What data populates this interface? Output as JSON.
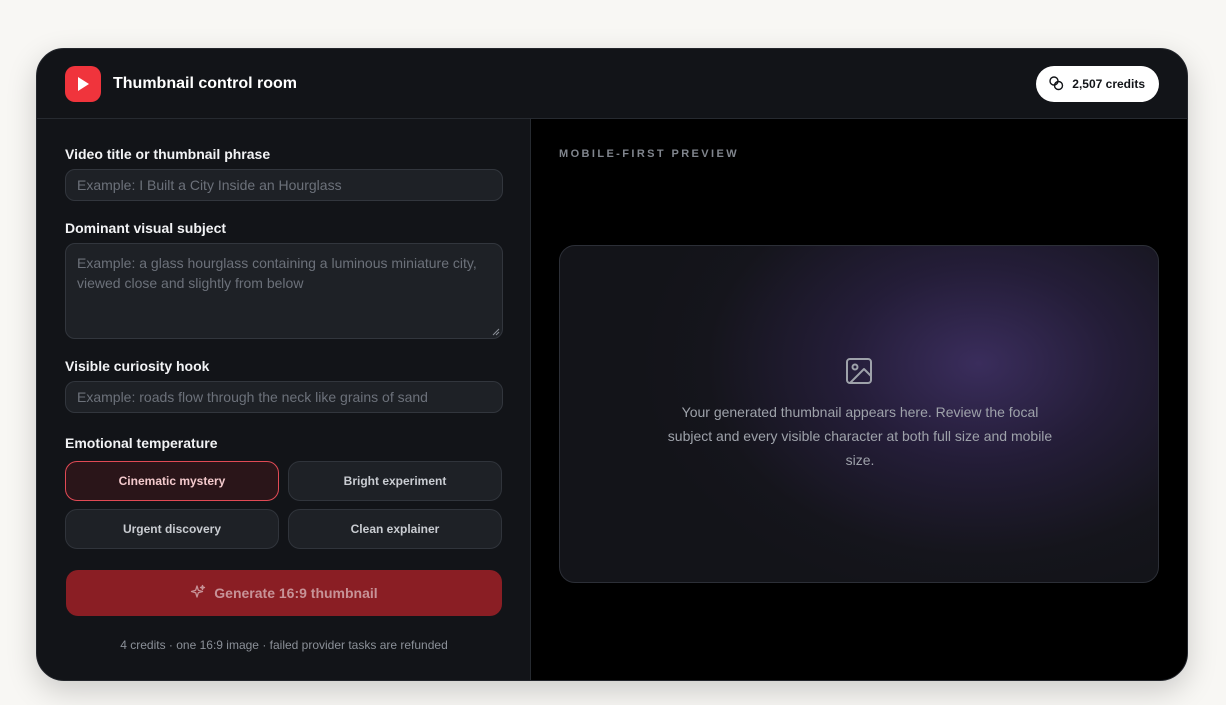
{
  "header": {
    "title": "Thumbnail control room",
    "credits": "2,507 credits"
  },
  "form": {
    "title_label": "Video title or thumbnail phrase",
    "title_placeholder": "Example: I Built a City Inside an Hourglass",
    "subject_label": "Dominant visual subject",
    "subject_placeholder": "Example: a glass hourglass containing a luminous miniature city, viewed close and slightly from below",
    "hook_label": "Visible curiosity hook",
    "hook_placeholder": "Example: roads flow through the neck like grains of sand",
    "temperature_label": "Emotional temperature",
    "temperatures": [
      {
        "label": "Cinematic mystery",
        "selected": true
      },
      {
        "label": "Bright experiment",
        "selected": false
      },
      {
        "label": "Urgent discovery",
        "selected": false
      },
      {
        "label": "Clean explainer",
        "selected": false
      }
    ],
    "generate_label": "Generate 16:9 thumbnail",
    "footnote": "4 credits · one 16:9 image · failed provider tasks are refunded"
  },
  "preview": {
    "label": "MOBILE-FIRST PREVIEW",
    "empty_text": "Your generated thumbnail appears here. Review the focal subject and every visible character at both full size and mobile size."
  },
  "colors": {
    "accent": "#f0343c",
    "panel": "#121418",
    "preview_bg": "#000000",
    "selected_chip_border": "#e14a55"
  },
  "icons": {
    "logo": "play-icon",
    "credits": "coins-icon",
    "generate": "sparkles-icon",
    "preview": "image-icon"
  }
}
